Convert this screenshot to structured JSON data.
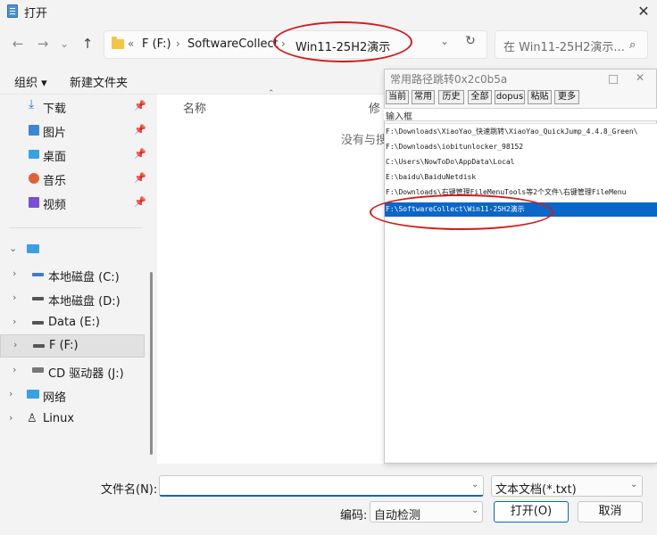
{
  "window": {
    "title": "打开",
    "close_glyph": "✕"
  },
  "nav": {
    "back": "←",
    "forward": "→",
    "recent": "⌄",
    "up": "↑",
    "breadcrumb": {
      "overflow": "«",
      "sep": "›",
      "drive": "F (F:)",
      "folder1": "SoftwareCollect",
      "folder2": "Win11-25H2演示"
    },
    "dropdown": "⌄",
    "refresh": "↻",
    "search_placeholder": "在 Win11-25H2演示...",
    "search_icon": "⌕"
  },
  "toolbar": {
    "organize": "组织 ▾",
    "new_folder": "新建文件夹"
  },
  "sidebar": {
    "quick_access": [
      {
        "label": "下载",
        "icon": "download-icon",
        "color": "#2a7ad5"
      },
      {
        "label": "图片",
        "icon": "pictures-icon",
        "color": "#3b86d8"
      },
      {
        "label": "桌面",
        "icon": "desktop-icon",
        "color": "#3aa0e6"
      },
      {
        "label": "音乐",
        "icon": "music-icon",
        "color": "#e0623a"
      },
      {
        "label": "视频",
        "icon": "videos-icon",
        "color": "#7a4fd6"
      }
    ],
    "pin": "📌",
    "this_pc_chevron": "⌄",
    "drives": [
      {
        "label": "本地磁盘 (C:)",
        "chevron": "›"
      },
      {
        "label": "本地磁盘 (D:)",
        "chevron": "›"
      },
      {
        "label": "Data (E:)",
        "chevron": "›"
      },
      {
        "label": "F (F:)",
        "chevron": "›"
      },
      {
        "label": "CD 驱动器 (J:)",
        "chevron": "›"
      },
      {
        "label": "网络",
        "chevron": "›"
      },
      {
        "label": "Linux",
        "chevron": "›"
      }
    ]
  },
  "main": {
    "columns": {
      "name": "名称",
      "modified": "修",
      "sort_arrow": "⌃"
    },
    "empty_message": "没有与搜"
  },
  "popup": {
    "title": "常用路径跳转0x2c0b5a",
    "tabs": [
      "当前",
      "常用",
      "历史",
      "全部",
      "dopus",
      "粘贴",
      "更多"
    ],
    "input_placeholder": "输入框",
    "items": [
      "F:\\Downloads\\XiaoYao_快速跳转\\XiaoYao_QuickJump_4.4.8_Green\\",
      "F:\\Downloads\\iobitunlocker_98152",
      "C:\\Users\\NowToDo\\AppData\\Local",
      "E:\\baidu\\BaiduNetdisk",
      "F:\\Downloads\\右键管理FileMenuTools等2个文件\\右键管理FileMenu",
      "F:\\SoftwareCollect\\Win11-25H2演示"
    ],
    "selected_index": 5,
    "selected_color": "#0a66c7"
  },
  "footer": {
    "filename_label": "文件名(N):",
    "filename_value": "",
    "filetype_value": "文本文档(*.txt)",
    "encoding_label": "编码:",
    "encoding_value": "自动检测",
    "open_button": "打开(O)",
    "cancel_button": "取消",
    "dropdown_glyph": "⌄"
  },
  "annotation_color": "#d31a1a"
}
